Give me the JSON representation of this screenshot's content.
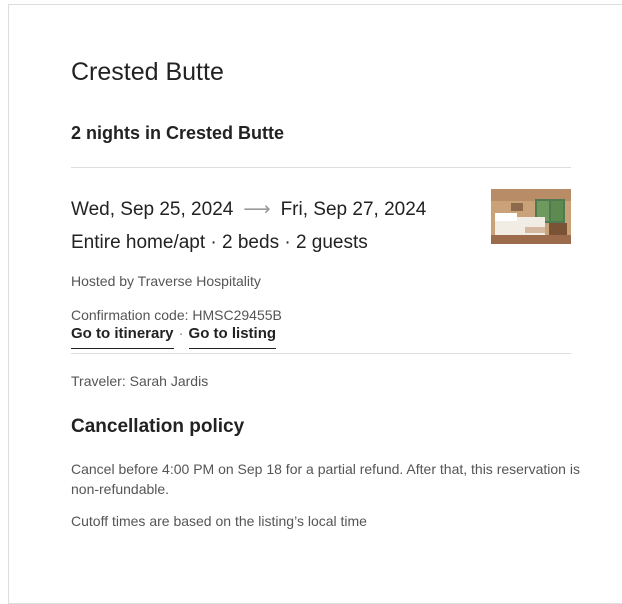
{
  "trip": {
    "title": "Crested Butte",
    "subtitle": "2 nights in Crested Butte"
  },
  "reservation": {
    "check_in": "Wed, Sep 25, 2024",
    "arrow_icon": "long-right-arrow-icon",
    "check_out": "Fri, Sep 27, 2024",
    "details": "Entire home/apt · 2 beds · 2 guests",
    "hosted_by": "Hosted by Traverse Hospitality",
    "confirmation": "Confirmation code: HMSC29455B",
    "links": {
      "itinerary": "Go to itinerary",
      "separator": "·",
      "listing": "Go to listing"
    },
    "traveler": "Traveler: Sarah Jardis"
  },
  "cancellation": {
    "heading": "Cancellation policy",
    "policy_text": "Cancel before 4:00 PM on Sep 18 for a partial refund. After that, this reservation is non-refundable.",
    "cutoff_note": "Cutoff times are based on the listing’s local time"
  },
  "colors": {
    "text_primary": "#222222",
    "text_secondary": "#555555",
    "divider": "#dddddd",
    "arrow": "#9a9a9a"
  }
}
